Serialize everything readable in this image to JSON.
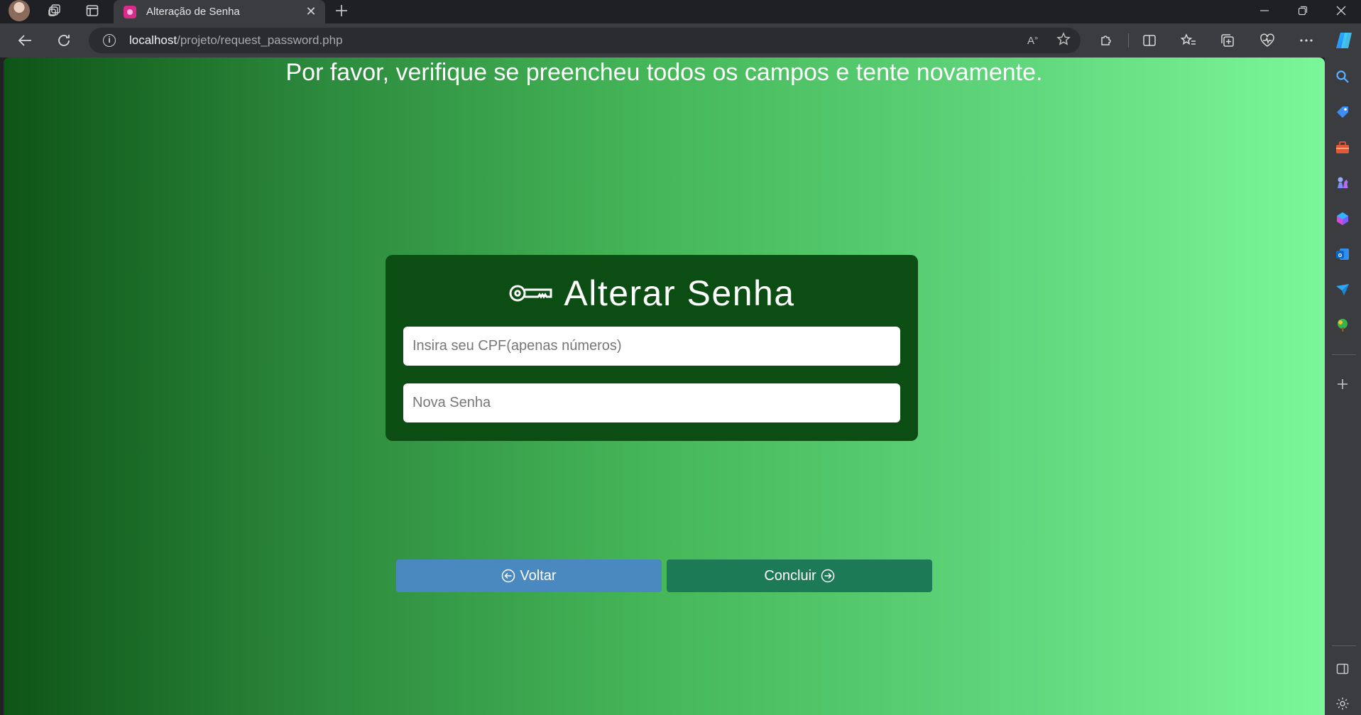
{
  "browser": {
    "tab": {
      "title": "Alteração de Senha"
    },
    "address": {
      "host": "localhost",
      "path": "/projeto/request_password.php"
    },
    "icons": {
      "profile": "profile-avatar",
      "workspaces": "workspaces-icon",
      "tab_actions": "tab-actions-icon",
      "new_tab": "plus-icon",
      "back": "back-arrow-icon",
      "refresh": "refresh-icon",
      "read_aloud": "read-aloud-icon",
      "favorite": "star-icon",
      "extensions": "puzzle-icon",
      "split_screen": "split-screen-icon",
      "favorites": "favorites-icon",
      "collections": "collections-icon",
      "browser_essentials": "heart-pulse-icon",
      "more": "more-icon",
      "copilot": "copilot-icon"
    }
  },
  "sidebar": {
    "items": [
      "search-icon",
      "tag-icon",
      "briefcase-icon",
      "chess-icon",
      "microsoft-365-icon",
      "outlook-icon",
      "send-icon",
      "tree-icon"
    ],
    "add": "plus-icon",
    "bottom": [
      "sidebar-toggle-icon",
      "settings-icon"
    ]
  },
  "page": {
    "error_message": "Por favor, verifique se preencheu todos os campos e tente novamente.",
    "card": {
      "title": "Alterar Senha",
      "title_icon": "key-icon",
      "cpf_placeholder": "Insira seu CPF(apenas números)",
      "password_placeholder": "Nova Senha"
    },
    "buttons": {
      "back_label": "Voltar",
      "submit_label": "Concluir"
    },
    "colors": {
      "gradient_start": "#0e5417",
      "gradient_end": "#7af798",
      "card": "#0b4d12",
      "back_button": "#4a88c0",
      "submit_button": "#1d7a57"
    }
  }
}
